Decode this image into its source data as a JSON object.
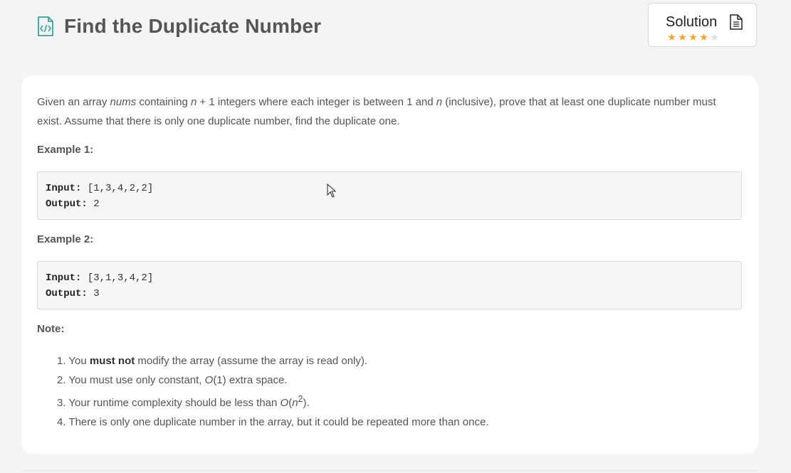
{
  "problem": {
    "title": "Find the Duplicate Number",
    "description": {
      "t1": "Given an array ",
      "nums": "nums",
      "t2": " containing ",
      "n1": "n",
      "t3": " + 1 integers where each integer is between 1 and ",
      "n2": "n",
      "t4": " (inclusive), prove that at least one duplicate number must exist. Assume that there is only one duplicate number, find the duplicate one."
    }
  },
  "solution": {
    "label": "Solution",
    "rating": 4,
    "max_rating": 5,
    "star_color": "#f5a623"
  },
  "examples": [
    {
      "heading": "Example 1:",
      "input_label": "Input:",
      "input": " [1,3,4,2,2]",
      "output_label": "Output:",
      "output": " 2"
    },
    {
      "heading": "Example 2:",
      "input_label": "Input:",
      "input": " [3,1,3,4,2]",
      "output_label": "Output:",
      "output": " 3"
    }
  ],
  "note": {
    "heading": "Note:",
    "items": [
      {
        "num": "1.",
        "a": " You ",
        "b": "must not",
        "c": " modify the array (assume the array is read only)."
      },
      {
        "num": "2.",
        "a": " You must use only constant, ",
        "o": "O",
        "c": "(1) extra space."
      },
      {
        "num": "3.",
        "a": " Your runtime complexity should be less than ",
        "o": "O",
        "p": "(",
        "n": "n",
        "sup": "2",
        "c": ")."
      },
      {
        "num": "4.",
        "a": " There is only one duplicate number in the array, but it could be repeated more than once."
      }
    ]
  },
  "colors": {
    "accent": "#3aa3a3",
    "star": "#f5a623",
    "star_empty": "#dcdcdc"
  },
  "icons": {
    "title_icon": "code-file-icon",
    "solution_icon": "document-icon"
  }
}
